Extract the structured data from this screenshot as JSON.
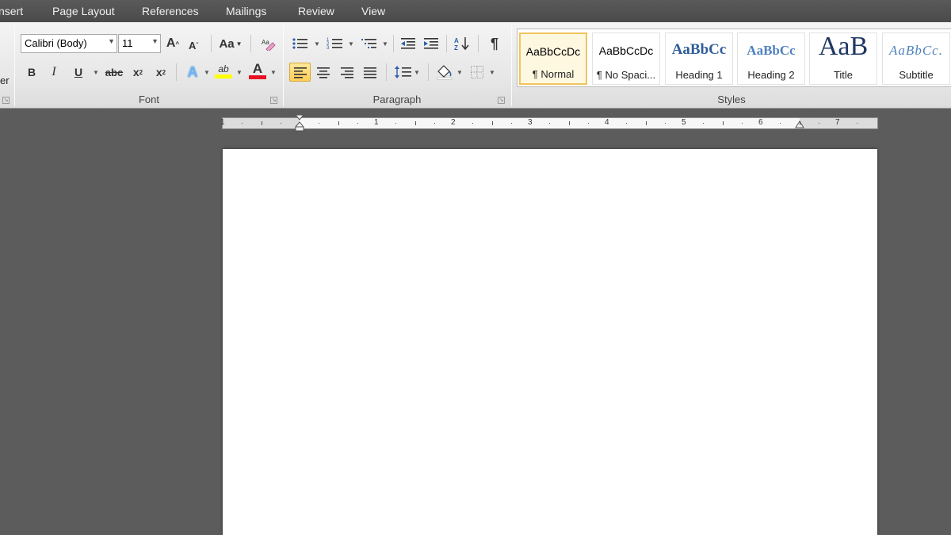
{
  "menu": {
    "tabs": [
      "nsert",
      "Page Layout",
      "References",
      "Mailings",
      "Review",
      "View"
    ]
  },
  "clipboard_fragment": "er",
  "font": {
    "family": "Calibri (Body)",
    "size": "11",
    "grow_label": "A",
    "shrink_label": "A",
    "change_case_label": "Aa",
    "bold": "B",
    "italic": "I",
    "underline": "U",
    "strike": "abc",
    "subscript": "x",
    "superscript": "x",
    "text_effects_label": "A",
    "highlight_label": "ab",
    "font_color_label": "A",
    "group_label": "Font",
    "highlight_color": "#ffff00",
    "font_color": "#e81123"
  },
  "paragraph": {
    "show_marks": "¶",
    "group_label": "Paragraph"
  },
  "styles": {
    "group_label": "Styles",
    "items": [
      {
        "sample": "AaBbCcDc",
        "name": "¶ Normal"
      },
      {
        "sample": "AaBbCcDc",
        "name": "¶ No Spaci..."
      },
      {
        "sample": "AaBbCc",
        "name": "Heading 1"
      },
      {
        "sample": "AaBbCc",
        "name": "Heading 2"
      },
      {
        "sample": "AaB",
        "name": "Title"
      },
      {
        "sample": "AaBbCc.",
        "name": "Subtitle"
      }
    ]
  },
  "ruler": {
    "labels": [
      "1",
      "1",
      "2",
      "3",
      "4",
      "5",
      "6",
      "7"
    ]
  }
}
